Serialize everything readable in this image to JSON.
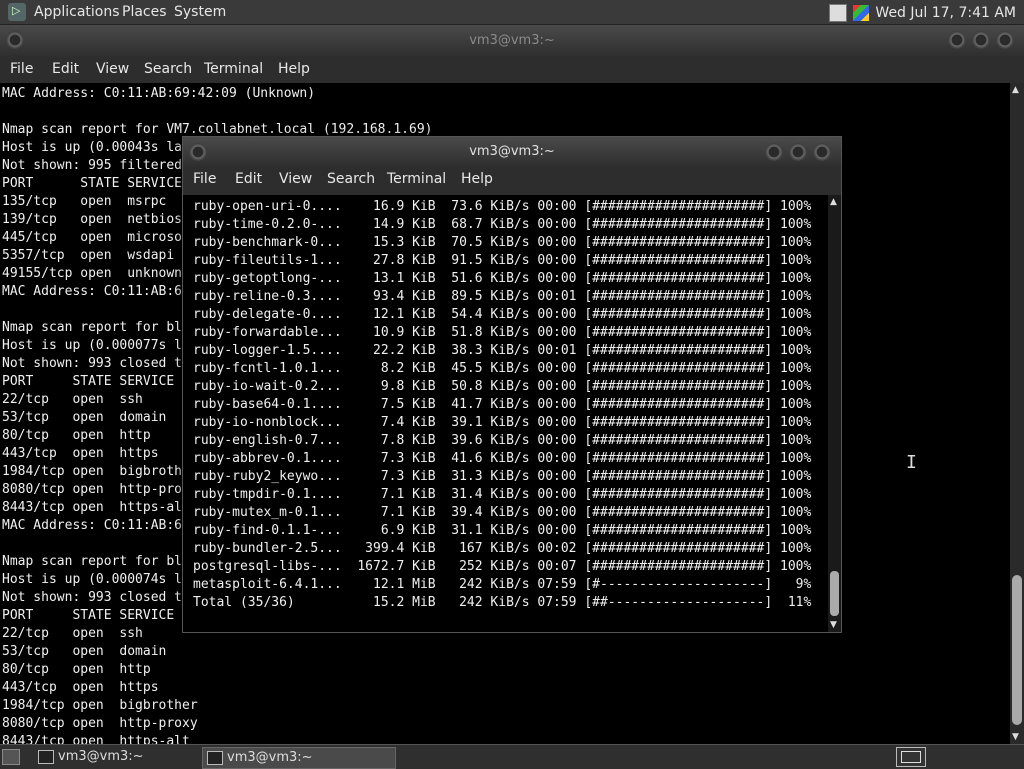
{
  "top_panel": {
    "menus": [
      "Applications",
      "Places",
      "System"
    ],
    "clock": "Wed Jul 17,  7:41 AM"
  },
  "bg_window": {
    "title": "vm3@vm3:~",
    "menu": [
      "File",
      "Edit",
      "View",
      "Search",
      "Terminal",
      "Help"
    ],
    "lines": [
      "MAC Address: C0:11:AB:69:42:09 (Unknown)",
      "",
      "Nmap scan report for VM7.collabnet.local (192.168.1.69)",
      "Host is up (0.00043s la",
      "Not shown: 995 filtered",
      "PORT      STATE SERVICE",
      "135/tcp   open  msrpc",
      "139/tcp   open  netbios",
      "445/tcp   open  microso",
      "5357/tcp  open  wsdapi",
      "49155/tcp open  unknown",
      "MAC Address: C0:11:AB:6",
      "",
      "Nmap scan report for bl",
      "Host is up (0.000077s l",
      "Not shown: 993 closed t",
      "PORT     STATE SERVICE",
      "22/tcp   open  ssh",
      "53/tcp   open  domain",
      "80/tcp   open  http",
      "443/tcp  open  https",
      "1984/tcp open  bigbroth",
      "8080/tcp open  http-pro",
      "8443/tcp open  https-al",
      "MAC Address: C0:11:AB:6",
      "",
      "Nmap scan report for bl",
      "Host is up (0.000074s l",
      "Not shown: 993 closed t",
      "PORT     STATE SERVICE",
      "22/tcp   open  ssh",
      "53/tcp   open  domain",
      "80/tcp   open  http",
      "443/tcp  open  https",
      "1984/tcp open  bigbrother",
      "8080/tcp open  http-proxy",
      "8443/tcp open  https-alt"
    ]
  },
  "fg_window": {
    "title": "vm3@vm3:~",
    "menu": [
      "File",
      "Edit",
      "View",
      "Search",
      "Terminal",
      "Help"
    ],
    "lines": [
      "ruby-open-uri-0....    16.9 KiB  73.6 KiB/s 00:00 [######################] 100%",
      "ruby-time-0.2.0-...    14.9 KiB  68.7 KiB/s 00:00 [######################] 100%",
      "ruby-benchmark-0...    15.3 KiB  70.5 KiB/s 00:00 [######################] 100%",
      "ruby-fileutils-1...    27.8 KiB  91.5 KiB/s 00:00 [######################] 100%",
      "ruby-getoptlong-...    13.1 KiB  51.6 KiB/s 00:00 [######################] 100%",
      "ruby-reline-0.3....    93.4 KiB  89.5 KiB/s 00:01 [######################] 100%",
      "ruby-delegate-0....    12.1 KiB  54.4 KiB/s 00:00 [######################] 100%",
      "ruby-forwardable...    10.9 KiB  51.8 KiB/s 00:00 [######################] 100%",
      "ruby-logger-1.5....    22.2 KiB  38.3 KiB/s 00:01 [######################] 100%",
      "ruby-fcntl-1.0.1...     8.2 KiB  45.5 KiB/s 00:00 [######################] 100%",
      "ruby-io-wait-0.2...     9.8 KiB  50.8 KiB/s 00:00 [######################] 100%",
      "ruby-base64-0.1....     7.5 KiB  41.7 KiB/s 00:00 [######################] 100%",
      "ruby-io-nonblock...     7.4 KiB  39.1 KiB/s 00:00 [######################] 100%",
      "ruby-english-0.7...     7.8 KiB  39.6 KiB/s 00:00 [######################] 100%",
      "ruby-abbrev-0.1....     7.3 KiB  41.6 KiB/s 00:00 [######################] 100%",
      "ruby-ruby2_keywo...     7.3 KiB  31.3 KiB/s 00:00 [######################] 100%",
      "ruby-tmpdir-0.1....     7.1 KiB  31.4 KiB/s 00:00 [######################] 100%",
      "ruby-mutex_m-0.1...     7.1 KiB  39.4 KiB/s 00:00 [######################] 100%",
      "ruby-find-0.1.1-...     6.9 KiB  31.1 KiB/s 00:00 [######################] 100%",
      "ruby-bundler-2.5...   399.4 KiB   167 KiB/s 00:02 [######################] 100%",
      "postgresql-libs-...  1672.7 KiB   252 KiB/s 00:07 [######################] 100%",
      "metasploit-6.4.1...    12.1 MiB   242 KiB/s 07:59 [#---------------------]   9%",
      "Total (35/36)          15.2 MiB   242 KiB/s 07:59 [##--------------------]  11%"
    ]
  },
  "taskbar": {
    "tasks": [
      "vm3@vm3:~",
      "vm3@vm3:~"
    ]
  }
}
